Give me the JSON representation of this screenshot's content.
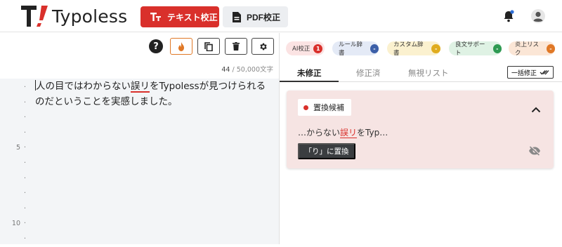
{
  "header": {
    "logo_text": "Typoless",
    "text_button_label": "テキスト校正",
    "pdf_button_label": "PDF校正"
  },
  "toolbar": {
    "char_count": "44",
    "char_total": "50,000文字"
  },
  "editor": {
    "line_numbers": [
      "",
      "",
      "",
      "",
      "5",
      "",
      "",
      "",
      "",
      "10",
      ""
    ],
    "line1_pre": "人の目ではわからない",
    "line1_err": "誤リ",
    "line1_post": "をTypolessが見つけられる",
    "line2": "のだということを実感しました。"
  },
  "chips": [
    {
      "label": "AI校正",
      "badge": "1",
      "bg": "#fbe3e3",
      "badge_color": "#d9302b"
    },
    {
      "label": "ルール辞書",
      "badge": "-",
      "bg": "#e4eaf6",
      "badge_color": "#3c5fa8"
    },
    {
      "label": "カスタム辞書",
      "badge": "-",
      "bg": "#fbf1cf",
      "badge_color": "#e0ac1e"
    },
    {
      "label": "良文サポート",
      "badge": "-",
      "bg": "#dff2e4",
      "badge_color": "#2e9a52"
    },
    {
      "label": "炎上リスク",
      "badge": "-",
      "bg": "#fbe6d6",
      "badge_color": "#e07826"
    }
  ],
  "tabs": {
    "unfixed": "未修正",
    "fixed": "修正済",
    "ignored": "無視リスト",
    "bulk_fix": "一括修正"
  },
  "card": {
    "label": "置換候補",
    "snippet_pre": "…からない",
    "snippet_err": "誤リ",
    "snippet_post": "をTyp…",
    "replace_button": "「り」に置換"
  },
  "colors": {
    "brand_red": "#d9302b",
    "card_bg": "#f6e4e3"
  }
}
